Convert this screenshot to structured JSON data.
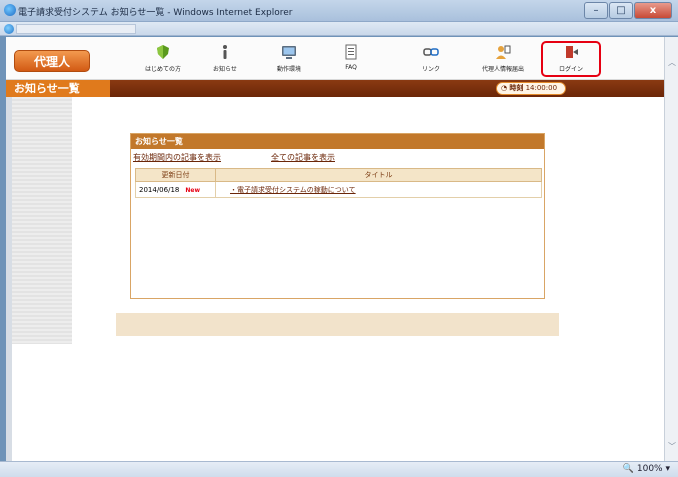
{
  "window": {
    "title": "電子請求受付システム お知らせ一覧 - Windows Internet Explorer",
    "controls": [
      "–",
      "□",
      "x"
    ]
  },
  "header": {
    "agent_button": "代理人",
    "nav": [
      {
        "label": "はじめての方",
        "icon": "shield-icon"
      },
      {
        "label": "お知らせ",
        "icon": "info-icon"
      },
      {
        "label": "動作環境",
        "icon": "monitor-icon"
      },
      {
        "label": "FAQ",
        "icon": "document-icon"
      },
      {
        "label": "リンク",
        "icon": "link-icon"
      },
      {
        "label": "代理人情報届出",
        "icon": "user-form-icon"
      },
      {
        "label": "ログイン",
        "icon": "login-icon"
      }
    ]
  },
  "bar": {
    "title": "お知らせ一覧",
    "clock_label": "時刻",
    "clock_time": "14:00:00"
  },
  "notice": {
    "title": "お知らせ一覧",
    "link_valid": "有効期間内の記事を表示",
    "link_all": "全ての記事を表示",
    "columns": [
      "更新日付",
      "タイトル"
    ],
    "rows": [
      {
        "date": "2014/06/18",
        "badge": "New",
        "title": "・電子請求受付システムの稼動について"
      }
    ]
  },
  "status": {
    "zoom": "100%"
  },
  "colors": {
    "accent": "#e07a1c",
    "bar": "#6b2608",
    "highlight": "#e60012"
  }
}
